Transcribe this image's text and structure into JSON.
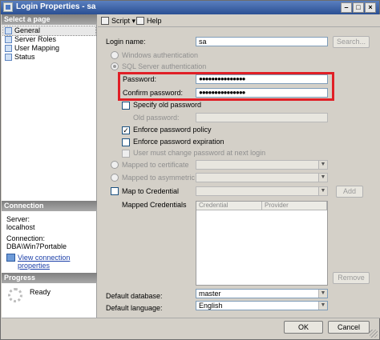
{
  "window": {
    "title": "Login Properties - sa"
  },
  "sidebar": {
    "select_header": "Select a page",
    "pages": [
      {
        "label": "General",
        "icon": "page-icon"
      },
      {
        "label": "Server Roles",
        "icon": "page-icon"
      },
      {
        "label": "User Mapping",
        "icon": "page-icon"
      },
      {
        "label": "Status",
        "icon": "page-icon"
      }
    ],
    "connection_header": "Connection",
    "server_label": "Server:",
    "server_value": "localhost",
    "connection_label": "Connection:",
    "connection_value": "DBA\\Win7Portable",
    "view_connection_link": "View connection properties",
    "progress_header": "Progress",
    "progress_status": "Ready"
  },
  "toolbar": {
    "script_label": "Script",
    "help_label": "Help"
  },
  "form": {
    "login_name_label": "Login name:",
    "login_name_value": "sa",
    "search_button": "Search...",
    "windows_auth_label": "Windows authentication",
    "sql_auth_label": "SQL Server authentication",
    "password_label": "Password:",
    "password_value": "●●●●●●●●●●●●●●●",
    "confirm_password_label": "Confirm password:",
    "confirm_password_value": "●●●●●●●●●●●●●●●",
    "specify_old_password_label": "Specify old password",
    "old_password_label": "Old password:",
    "enforce_policy_label": "Enforce password policy",
    "enforce_expiration_label": "Enforce password expiration",
    "must_change_label": "User must change password at next login",
    "mapped_cert_label": "Mapped to certificate",
    "mapped_asym_label": "Mapped to asymmetric key",
    "map_credential_label": "Map to Credential",
    "add_button": "Add",
    "mapped_credentials_label": "Mapped Credentials",
    "credential_col": "Credential",
    "provider_col": "Provider",
    "remove_button": "Remove",
    "default_database_label": "Default database:",
    "default_database_value": "master",
    "default_language_label": "Default language:",
    "default_language_value": "English"
  },
  "footer": {
    "ok_button": "OK",
    "cancel_button": "Cancel"
  },
  "colors": {
    "highlight": "#e01f26",
    "title_bar": "#2a4f93",
    "link": "#1b3fa8"
  }
}
